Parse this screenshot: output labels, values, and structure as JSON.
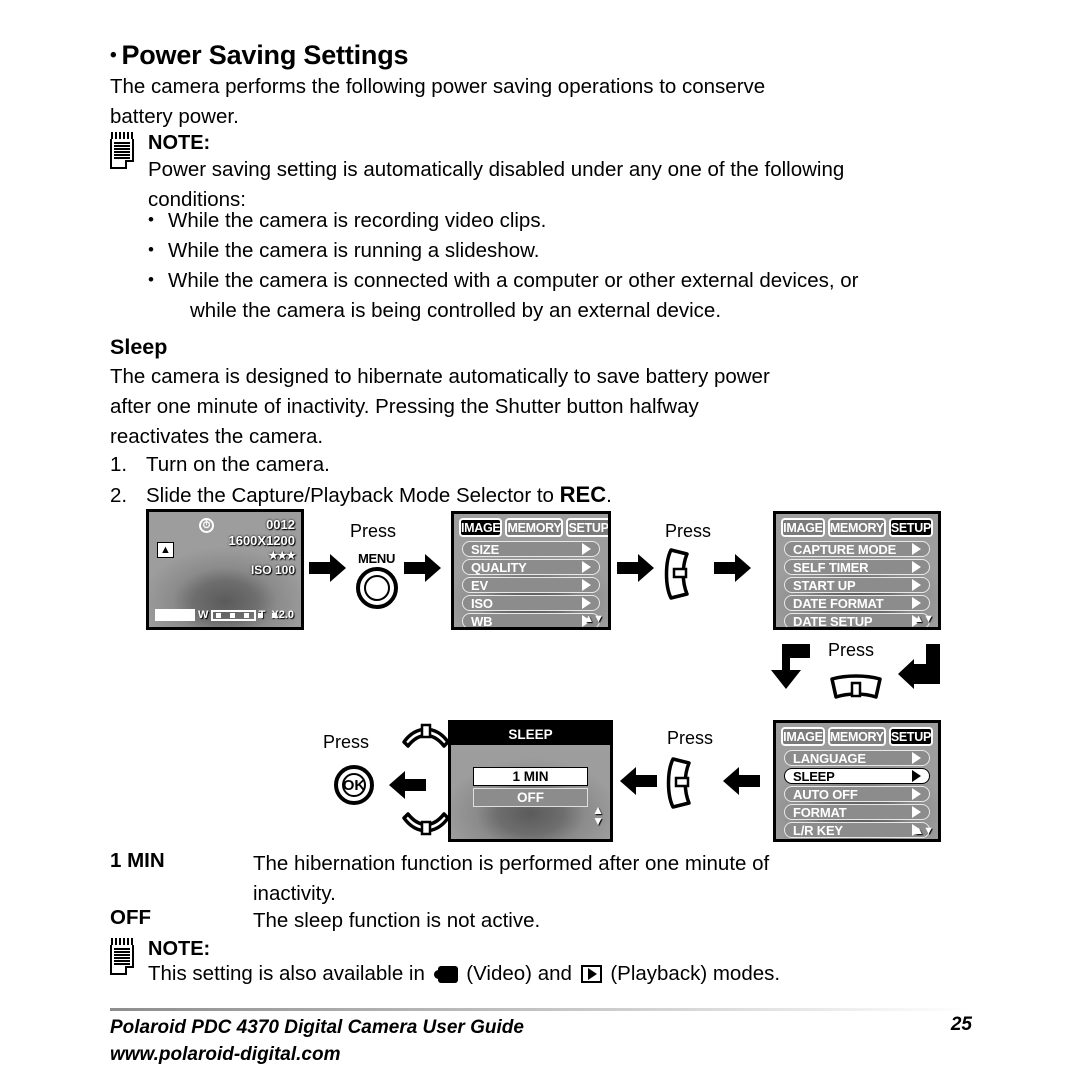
{
  "page": {
    "title": "Power Saving Settings",
    "title_bullet": "•",
    "intro_line1": "The camera performs the following power saving operations to conserve",
    "intro_line2": "battery power."
  },
  "note_top": {
    "icon": "notepad-icon",
    "label": "NOTE:",
    "body_line1": "Power saving setting is automatically disabled under any one of the following",
    "body_line2": "conditions:",
    "bullets": [
      "While the camera is recording video clips.",
      "While the camera is running a slideshow.",
      "While the camera is connected with a computer or other external devices, or",
      "while the camera is being controlled by an external device."
    ]
  },
  "sleep_section": {
    "heading": "Sleep",
    "paragraph_line1": "The camera is designed to hibernate automatically to save battery power",
    "paragraph_line2": "after one minute of inactivity. Pressing the Shutter button halfway",
    "paragraph_line3": "reactivates the camera.",
    "steps": [
      {
        "num": "1.",
        "text_before": "Turn on the camera.",
        "bold": "",
        "text_after": ""
      },
      {
        "num": "2.",
        "text_before": "Slide the Capture/Playback Mode Selector to ",
        "bold": "REC",
        "text_after": "."
      }
    ]
  },
  "flow": {
    "press_label": "Press",
    "menu_button_caption": "MENU",
    "ok_button_caption": "OK",
    "preview_screen": {
      "name": "camera-preview-lcd",
      "counter": "0012",
      "resolution": "1600X1200",
      "quality": "★★★",
      "iso": "ISO 100",
      "self_timer_icon": "self-timer-icon",
      "mode_icon": "auto-mode-icon",
      "zoom_wide_label": "W",
      "zoom_tele_label": "T",
      "zoom_factor": "X2.0"
    },
    "image_menu": {
      "name": "image-menu-screen",
      "tabs": [
        {
          "label": "IMAGE",
          "active": true
        },
        {
          "label": "MEMORY",
          "active": false
        },
        {
          "label": "SETUP",
          "active": false
        }
      ],
      "items": [
        {
          "label": "SIZE",
          "selected": false
        },
        {
          "label": "QUALITY",
          "selected": false
        },
        {
          "label": "EV",
          "selected": false
        },
        {
          "label": "ISO",
          "selected": false
        },
        {
          "label": "WB",
          "selected": false
        }
      ]
    },
    "setup_menu_1": {
      "name": "setup-menu-screen-page1",
      "tabs": [
        {
          "label": "IMAGE",
          "active": false
        },
        {
          "label": "MEMORY",
          "active": false
        },
        {
          "label": "SETUP",
          "active": true
        }
      ],
      "items": [
        {
          "label": "CAPTURE MODE",
          "selected": false
        },
        {
          "label": "SELF TIMER",
          "selected": false
        },
        {
          "label": "START UP",
          "selected": false
        },
        {
          "label": "DATE FORMAT",
          "selected": false
        },
        {
          "label": "DATE SETUP",
          "selected": false
        }
      ]
    },
    "setup_menu_2": {
      "name": "setup-menu-screen-page2",
      "tabs": [
        {
          "label": "IMAGE",
          "active": false
        },
        {
          "label": "MEMORY",
          "active": false
        },
        {
          "label": "SETUP",
          "active": true
        }
      ],
      "items": [
        {
          "label": "LANGUAGE",
          "selected": false
        },
        {
          "label": "SLEEP",
          "selected": true
        },
        {
          "label": "AUTO OFF",
          "selected": false
        },
        {
          "label": "FORMAT",
          "selected": false
        },
        {
          "label": "L/R KEY",
          "selected": false
        }
      ]
    },
    "sleep_dialog": {
      "name": "sleep-dialog-screen",
      "title": "SLEEP",
      "options": [
        {
          "label": "1 MIN",
          "selected": true
        },
        {
          "label": "OFF",
          "selected": false
        }
      ]
    }
  },
  "definitions": [
    {
      "term": "1 MIN",
      "desc_line1": "The hibernation function is performed after one minute of",
      "desc_line2": "inactivity."
    },
    {
      "term": "OFF",
      "desc_line1": "The sleep function is not active.",
      "desc_line2": ""
    }
  ],
  "note_bottom": {
    "icon": "notepad-icon",
    "label": "NOTE:",
    "text_before": "This setting is also available in",
    "video_label": "(Video) and",
    "playback_label": "(Playback) modes."
  },
  "footer": {
    "line1": "Polaroid PDC 4370 Digital Camera User Guide",
    "line2": "www.polaroid-digital.com",
    "page_number": "25"
  }
}
